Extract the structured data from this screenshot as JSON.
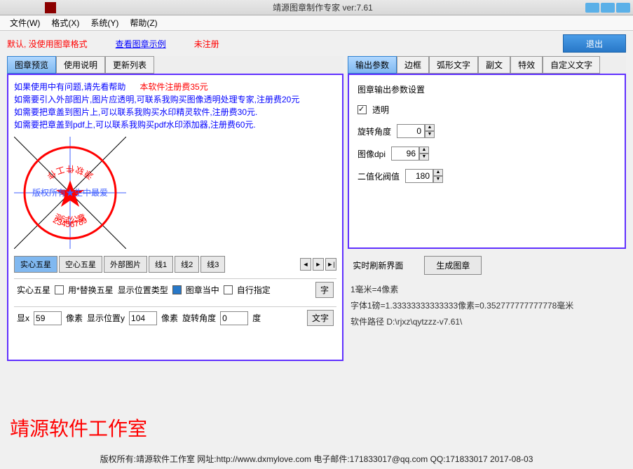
{
  "window": {
    "title": "靖源图章制作专家 ver:7.61"
  },
  "menu": {
    "file": "文件(W)",
    "format": "格式(X)",
    "system": "系统(Y)",
    "help": "帮助(Z)"
  },
  "topbar": {
    "status": "默认, 没使用图章格式",
    "link": "查看图章示例",
    "notreg": "未注册",
    "exit": "退出"
  },
  "left_tabs": [
    "图章预览",
    "使用说明",
    "更新列表"
  ],
  "help": {
    "l1a": "如果使用中有问题,请先看帮助",
    "l1b": "本软件注册费35元",
    "l2": "如需要引入外部图片,图片应透明,可联系我购买图像透明处理专家,注册费20元",
    "l3": "如需要把章盖到图片上,可以联系我购买水印精灵软件,注册费30元.",
    "l4": "如需要把章盖到pdf上,可以联系我购买pdf水印添加器,注册费60元."
  },
  "seal": {
    "owner": "版权所有",
    "mid": "生中最爱",
    "test": "测试公章",
    "nums": "23456789",
    "soft": "软件",
    "work": "工作",
    "shi": "室"
  },
  "shape_tabs": [
    "实心五星",
    "空心五星",
    "外部图片",
    "线1",
    "线2",
    "线3"
  ],
  "row1": {
    "label": "实心五星",
    "chk_txt": "用*替换五星",
    "pos_label": "显示位置类型",
    "pos_center": "图章当中",
    "pos_custom": "自行指定",
    "btn": "字"
  },
  "row2": {
    "x": "显x",
    "xv": "59",
    "px": "像素",
    "y": "显示位置y",
    "yv": "104",
    "rot": "旋转角度",
    "rv": "0",
    "deg": "度",
    "btn": "文字"
  },
  "right_tabs": [
    "输出参数",
    "边框",
    "弧形文字",
    "副文",
    "特效",
    "自定义文字"
  ],
  "output": {
    "group": "图章输出参数设置",
    "trans": "透明",
    "rot": "旋转角度",
    "rotv": "0",
    "dpi": "图像dpi",
    "dpiv": "96",
    "thr": "二值化阀值",
    "thrv": "180"
  },
  "lower": {
    "refresh": "实时刷新界面",
    "gen": "生成图章",
    "mm": "1毫米=4像素",
    "font": "字体1磅=1.33333333333333像素=0.352777777777778毫米",
    "path_l": "软件路径",
    "path_v": "D:\\rjxz\\qytzzz-v7.61\\"
  },
  "studio": "靖源软件工作室",
  "footer": "版权所有:靖源软件工作室 网址:http://www.dxmylove.com 电子邮件:171833017@qq.com QQ:171833017  2017-08-03"
}
